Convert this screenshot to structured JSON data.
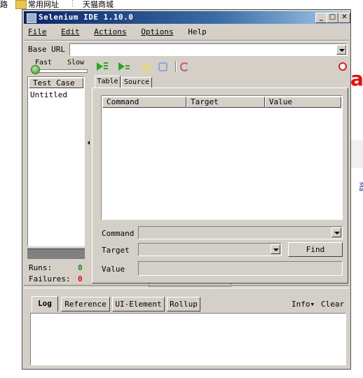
{
  "background": {
    "breadcrumb_fragment": "路",
    "bookmark_common": "常用网址",
    "bookmark_sep": "⋮",
    "bookmark_tmall": "天猫商城",
    "red_fragment": "a",
    "blue_fragment": "Ma"
  },
  "window": {
    "title": "Selenium IDE 1.10.0",
    "minimize": "_",
    "maximize": "□",
    "close": "✕"
  },
  "menu": [
    "File",
    "Edit",
    "Actions",
    "Options",
    "Help"
  ],
  "base_url": {
    "label": "Base URL",
    "value": ""
  },
  "speed": {
    "fast": "Fast",
    "slow": "Slow"
  },
  "test_case_panel": {
    "header": "Test Case",
    "items": [
      "Untitled"
    ],
    "runs_label": "Runs:",
    "runs_value": "0",
    "failures_label": "Failures:",
    "failures_value": "0"
  },
  "editor": {
    "tabs": [
      "Table",
      "Source"
    ],
    "columns": [
      "Command",
      "Target",
      "Value"
    ],
    "command_label": "Command",
    "target_label": "Target",
    "value_label": "Value",
    "find_button": "Find"
  },
  "log_panel": {
    "tabs": [
      "Log",
      "Reference",
      "UI-Element",
      "Rollup"
    ],
    "info": "Info▾",
    "clear": "Clear"
  },
  "colors": {
    "title_start": "#0a246a",
    "title_end": "#a6caf0",
    "play_green": "#2aa52a",
    "record_red": "#d82020",
    "runs_green": "#1a8a1a",
    "failures_red": "#d81010"
  }
}
